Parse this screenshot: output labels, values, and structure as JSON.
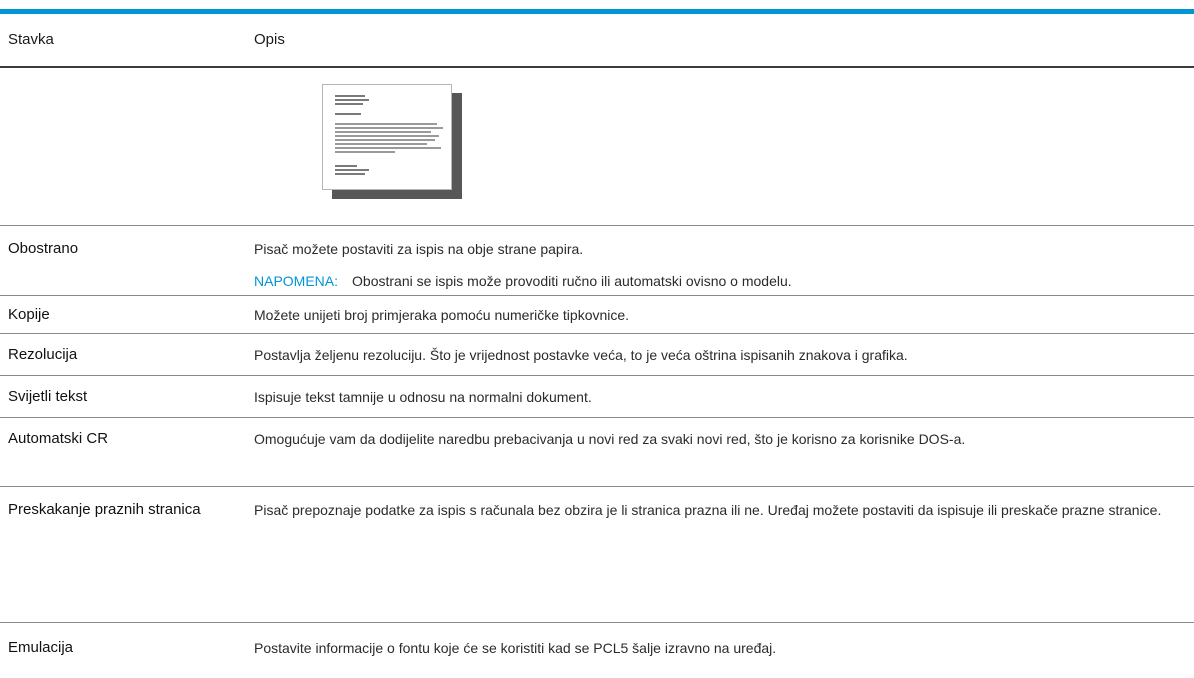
{
  "table": {
    "header": {
      "item": "Stavka",
      "desc": "Opis"
    },
    "figure": {
      "icon": "document-thumbnail-icon"
    },
    "rows": [
      {
        "item": "Obostrano",
        "desc": "Pisač možete postaviti za ispis na obje strane papira.",
        "note_label": "NAPOMENA:",
        "note_text": "Obostrani se ispis može provoditi ručno ili automatski ovisno o modelu."
      },
      {
        "item": "Kopije",
        "desc": "Možete unijeti broj primjeraka pomoću numeričke tipkovnice."
      },
      {
        "item": "Rezolucija",
        "desc": "Postavlja željenu rezoluciju. Što je vrijednost postavke veća, to je veća oštrina ispisanih znakova i grafika."
      },
      {
        "item": "Svijetli tekst",
        "desc": "Ispisuje tekst tamnije u odnosu na normalni dokument."
      },
      {
        "item": "Automatski CR",
        "desc": "Omogućuje vam da dodijelite naredbu prebacivanja u novi red za svaki novi red, što je korisno za korisnike DOS-a."
      },
      {
        "item": "Preskakanje praznih stranica",
        "desc": "Pisač prepoznaje podatke za ispis s računala bez obzira je li stranica prazna ili ne. Uređaj možete postaviti da ispisuje ili preskače prazne stranice."
      },
      {
        "item": "Emulacija",
        "desc": "Postavite informacije o fontu koje će se koristiti kad se PCL5 šalje izravno na uređaj."
      }
    ]
  },
  "colors": {
    "accent": "#0096d6",
    "rule": "#3c3c3c",
    "divider": "#8a8a8a"
  }
}
